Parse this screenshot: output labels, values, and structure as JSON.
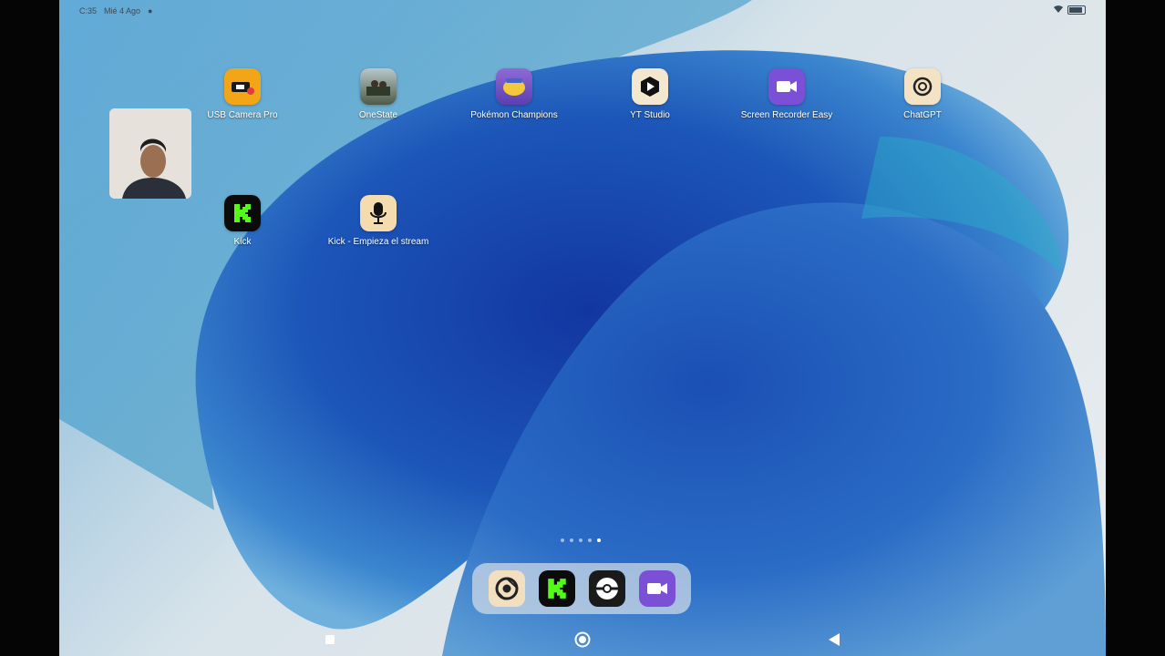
{
  "status": {
    "time": "C:35",
    "date": "Mié 4 Ago",
    "battery_label": "100"
  },
  "apps": [
    {
      "label": "USB Camera Pro",
      "icon": "usb-camera-icon"
    },
    {
      "label": "OneState",
      "icon": "onestate-icon"
    },
    {
      "label": "Pokémon Champions",
      "icon": "pokemon-icon"
    },
    {
      "label": "YT Studio",
      "icon": "yt-studio-icon"
    },
    {
      "label": "Screen Recorder Easy",
      "icon": "screen-recorder-icon"
    },
    {
      "label": "ChatGPT",
      "icon": "chatgpt-icon"
    },
    {
      "label": "Kick",
      "icon": "kick-icon"
    },
    {
      "label": "Kick - Empieza el stream",
      "icon": "microphone-icon"
    }
  ],
  "dock": [
    {
      "icon": "chrome-icon"
    },
    {
      "icon": "kick-icon"
    },
    {
      "icon": "pokeball-icon"
    },
    {
      "icon": "screen-recorder-icon"
    }
  ],
  "page_indicator": {
    "total": 5,
    "active": 5
  },
  "colors": {
    "accent_blue": "#1e5fb8",
    "kick_green": "#53fc18",
    "recorder_purple": "#7b4fd6"
  }
}
